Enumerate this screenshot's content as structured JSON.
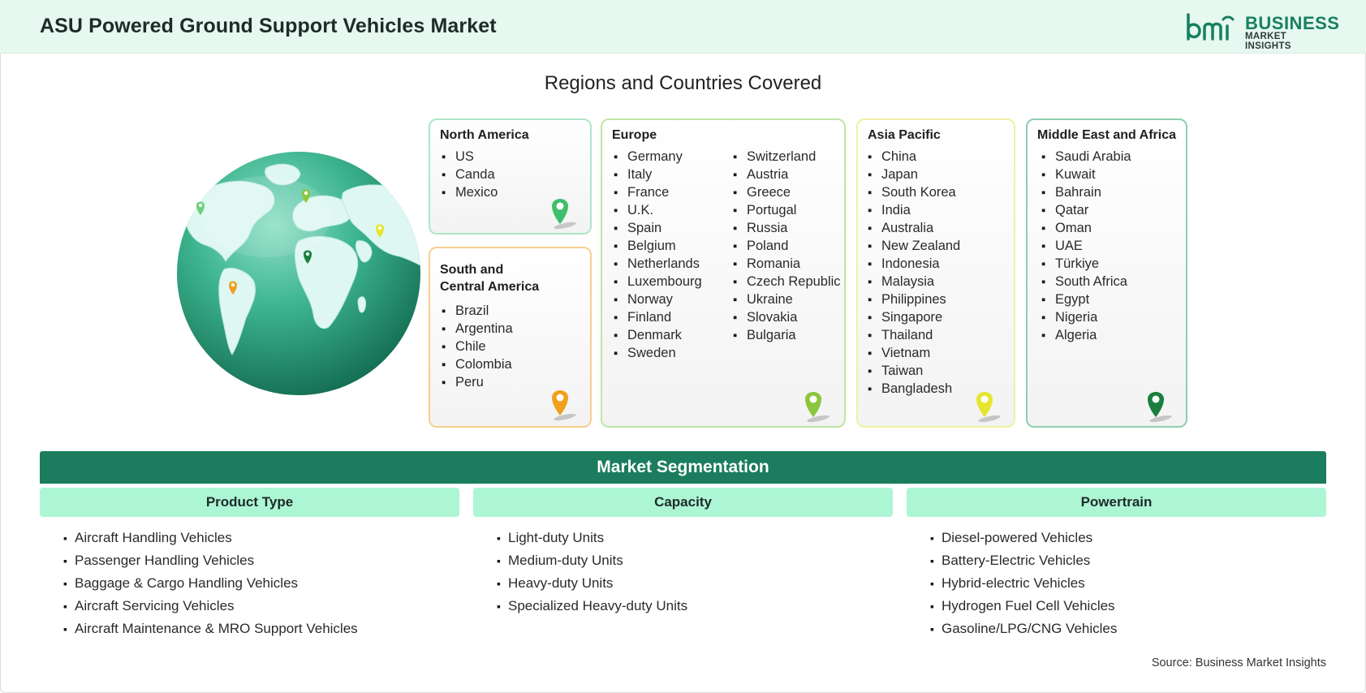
{
  "header": {
    "title": "ASU Powered Ground Support Vehicles Market",
    "logo_line1": "BUSINESS",
    "logo_line2": "MARKET INSIGHTS",
    "logo_mark": "bmi"
  },
  "regions": {
    "title": "Regions and Countries Covered",
    "north_america": {
      "title": "North America",
      "countries": [
        "US",
        "Canda",
        "Mexico"
      ],
      "pin_color": "#3fbf6b"
    },
    "south_central_america": {
      "title_line1": "South and",
      "title_line2": "Central America",
      "countries": [
        "Brazil",
        "Argentina",
        "Chile",
        "Colombia",
        "Peru"
      ],
      "pin_color": "#f0a020"
    },
    "europe": {
      "title": "Europe",
      "countries_col1": [
        "Germany",
        "Italy",
        "France",
        "U.K.",
        "Spain",
        "Belgium",
        "Netherlands",
        "Luxembourg",
        "Norway",
        "Finland",
        "Denmark",
        "Sweden"
      ],
      "countries_col2": [
        "Switzerland",
        "Austria",
        "Greece",
        "Portugal",
        "Russia",
        "Poland",
        "Romania",
        "Czech Republic",
        "Ukraine",
        "Slovakia",
        "Bulgaria"
      ],
      "pin_color": "#8cc63f"
    },
    "asia_pacific": {
      "title": "Asia Pacific",
      "countries": [
        "China",
        "Japan",
        "South Korea",
        "India",
        "Australia",
        "New Zealand",
        "Indonesia",
        "Malaysia",
        "Philippines",
        "Singapore",
        "Thailand",
        "Vietnam",
        "Taiwan",
        "Bangladesh"
      ],
      "pin_color": "#e6e630"
    },
    "middle_east_africa": {
      "title": "Middle East and Africa",
      "countries": [
        "Saudi Arabia",
        "Kuwait",
        "Bahrain",
        "Qatar",
        "Oman",
        "UAE",
        "Türkiye",
        "South Africa",
        "Egypt",
        "Nigeria",
        "Algeria"
      ],
      "pin_color": "#1a7f3c"
    }
  },
  "segmentation": {
    "title": "Market Segmentation",
    "columns": [
      {
        "heading": "Product Type",
        "items": [
          "Aircraft Handling Vehicles",
          "Passenger Handling Vehicles",
          "Baggage & Cargo Handling Vehicles",
          "Aircraft Servicing Vehicles",
          "Aircraft Maintenance & MRO Support Vehicles"
        ]
      },
      {
        "heading": "Capacity",
        "items": [
          "Light-duty Units",
          "Medium-duty Units",
          "Heavy-duty Units",
          "Specialized Heavy-duty Units"
        ]
      },
      {
        "heading": "Powertrain",
        "items": [
          "Diesel-powered Vehicles",
          "Battery-Electric Vehicles",
          "Hybrid-electric Vehicles",
          "Hydrogen Fuel Cell Vehicles",
          "Gasoline/LPG/CNG Vehicles"
        ]
      }
    ]
  },
  "source": "Source: Business Market Insights",
  "colors": {
    "header_bg": "#e6f8ef",
    "brand_green": "#1b7d5e",
    "segment_head_bg": "#adf6d4"
  },
  "icons": [
    "globe-illustration",
    "map-pin-icon",
    "bmi-logo"
  ]
}
